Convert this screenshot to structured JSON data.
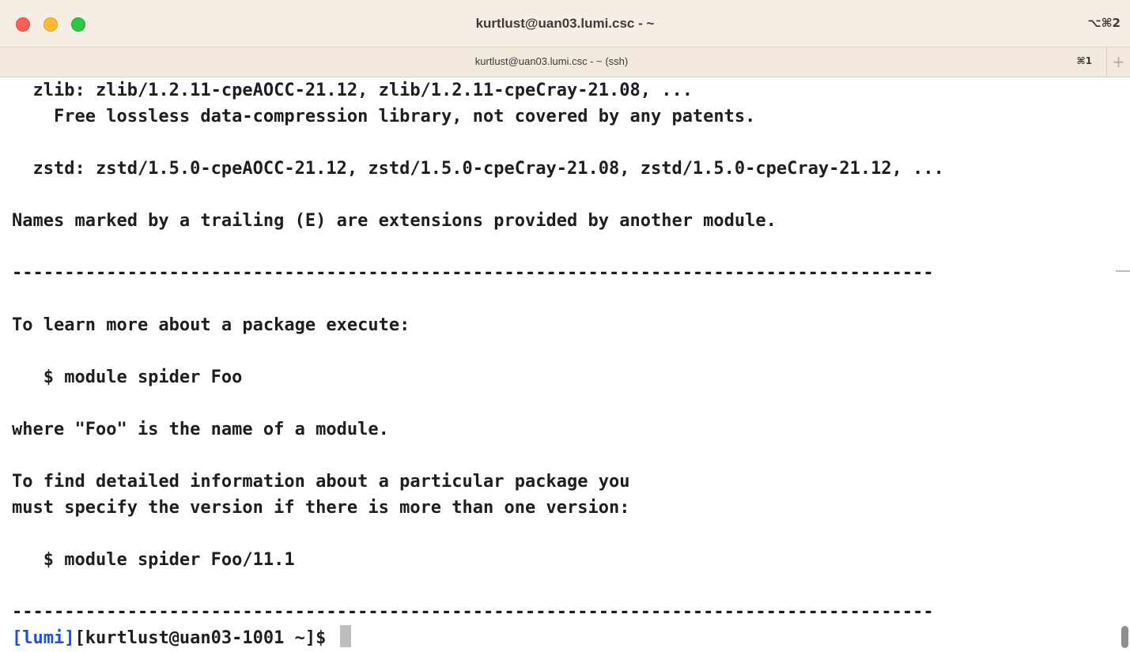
{
  "window": {
    "title": "kurtlust@uan03.lumi.csc - ~",
    "shortcut": "⌥⌘2"
  },
  "tab": {
    "title": "kurtlust@uan03.lumi.csc - ~ (ssh)",
    "shortcut": "⌘1",
    "new_tab_label": "+"
  },
  "terminal": {
    "lines": [
      "  zlib: zlib/1.2.11-cpeAOCC-21.12, zlib/1.2.11-cpeCray-21.08, ...",
      "    Free lossless data-compression library, not covered by any patents.",
      "",
      "  zstd: zstd/1.5.0-cpeAOCC-21.12, zstd/1.5.0-cpeCray-21.08, zstd/1.5.0-cpeCray-21.12, ...",
      "",
      "Names marked by a trailing (E) are extensions provided by another module.",
      "",
      "----------------------------------------------------------------------------------------",
      "",
      "To learn more about a package execute:",
      "",
      "   $ module spider Foo",
      "",
      "where \"Foo\" is the name of a module.",
      "",
      "To find detailed information about a particular package you",
      "must specify the version if there is more than one version:",
      "",
      "   $ module spider Foo/11.1",
      "",
      "----------------------------------------------------------------------------------------"
    ],
    "prompt": {
      "tag": "[lumi]",
      "user_host": "[kurtlust@uan03-1001 ~]$ "
    }
  },
  "colors": {
    "titlebar_bg": "#f6eee4",
    "tabbar_bg": "#f3e8dc",
    "prompt_tag": "#1f4fd8",
    "text": "#1e1e1e",
    "close": "#ff5f57",
    "minimize": "#febc2e",
    "maximize": "#28c840"
  }
}
